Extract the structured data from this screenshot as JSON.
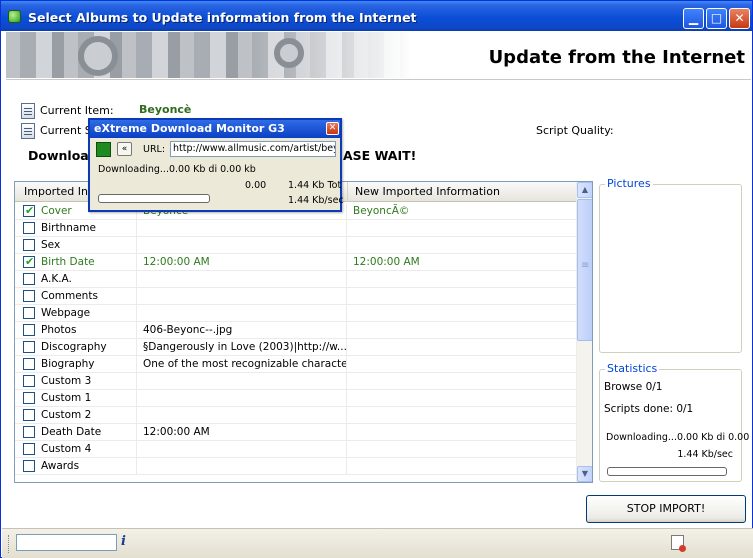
{
  "window": {
    "title": "Select Albums to Update information from the Internet"
  },
  "header": {
    "title": "Update from the Internet"
  },
  "info": {
    "current_item_label": "Current Item:",
    "current_item_value": "Beyoncè",
    "current_script_label": "Current Sc",
    "script_quality_label": "Script Quality:",
    "status_left": "Download",
    "status_right": "ASE WAIT!"
  },
  "grid": {
    "columns": [
      "Imported Info",
      "",
      "New Imported Information"
    ],
    "rows": [
      {
        "label": "Cover",
        "checked": true,
        "old": "Beyoncè",
        "new": "BeyoncÃ©"
      },
      {
        "label": "Birthname",
        "checked": false,
        "old": "",
        "new": ""
      },
      {
        "label": "Sex",
        "checked": false,
        "old": "",
        "new": ""
      },
      {
        "label": "Birth Date",
        "checked": true,
        "old": "12:00:00 AM",
        "new": "12:00:00 AM"
      },
      {
        "label": "A.K.A.",
        "checked": false,
        "old": "",
        "new": ""
      },
      {
        "label": "Comments",
        "checked": false,
        "old": "",
        "new": ""
      },
      {
        "label": "Webpage",
        "checked": false,
        "old": "",
        "new": ""
      },
      {
        "label": "Photos",
        "checked": false,
        "old": "406-Beyonc--.jpg",
        "new": ""
      },
      {
        "label": "Discography",
        "checked": false,
        "old": "§Dangerously in Love (2003)|http://w...",
        "new": ""
      },
      {
        "label": "Biography",
        "checked": false,
        "old": "One of the most recognizable characte...",
        "new": ""
      },
      {
        "label": "Custom 3",
        "checked": false,
        "old": "",
        "new": ""
      },
      {
        "label": "Custom 1",
        "checked": false,
        "old": "",
        "new": ""
      },
      {
        "label": "Custom 2",
        "checked": false,
        "old": "",
        "new": ""
      },
      {
        "label": "Death Date",
        "checked": false,
        "old": "12:00:00 AM",
        "new": ""
      },
      {
        "label": "Custom 4",
        "checked": false,
        "old": "",
        "new": ""
      },
      {
        "label": "Awards",
        "checked": false,
        "old": "",
        "new": ""
      }
    ]
  },
  "pictures": {
    "title": "Pictures"
  },
  "statistics": {
    "title": "Statistics",
    "browse": "Browse 0/1",
    "scripts_done": "Scripts done: 0/1",
    "downloading": "Downloading...0.00 Kb di 0.00",
    "speed": "1.44 Kb/sec",
    "progress": 0
  },
  "stop_button": "STOP IMPORT!",
  "popup": {
    "title": "eXtreme  Download Monitor G3",
    "url_label": "URL:",
    "url_value": "http://www.allmusic.com/artist/beyonc-",
    "downloading": "Downloading...0.00 Kb di 0.00 kb",
    "amount": "0.00",
    "total": "1.44 Kb Tot",
    "speed": "1.44 Kb/sec",
    "progress": 0,
    "collapse_label": "«"
  },
  "statusbar": {
    "input_value": ""
  },
  "colors": {
    "titlebar": "#0a4fd8",
    "accent_green": "#2f7a1d",
    "groupbox_title": "#0046d5"
  },
  "icons": {
    "app": "app-icon",
    "minimize": "minimize-icon",
    "maximize": "maximize-icon",
    "close": "close-icon",
    "info": "info-icon",
    "document": "document-icon"
  }
}
